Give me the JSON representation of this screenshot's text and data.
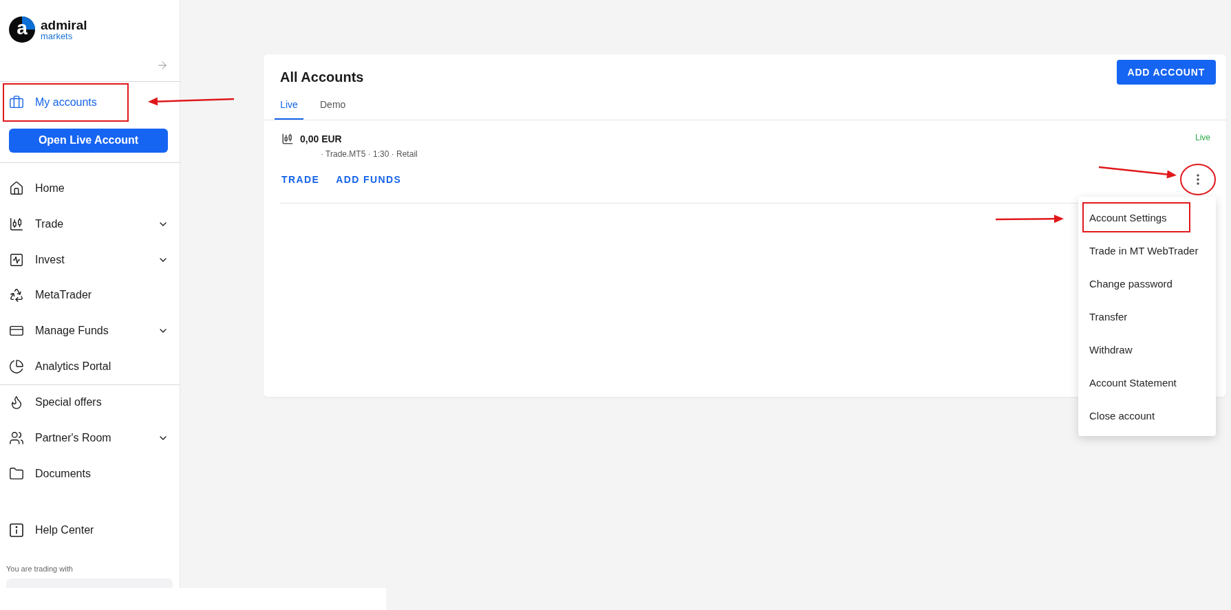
{
  "brand": {
    "mark": "a",
    "name": "admiral",
    "sub": "markets"
  },
  "sidebar": {
    "my_accounts": {
      "label": "My accounts",
      "selected": true,
      "highlighted": true
    },
    "cta": "Open Live Account",
    "items": [
      {
        "label": "Home",
        "kind": "home",
        "expandable": false
      },
      {
        "label": "Trade",
        "kind": "candles",
        "expandable": true
      },
      {
        "label": "Invest",
        "kind": "chart",
        "expandable": true
      },
      {
        "label": "MetaTrader",
        "kind": "recycle",
        "expandable": false
      },
      {
        "label": "Manage Funds",
        "kind": "card",
        "expandable": true
      },
      {
        "label": "Analytics Portal",
        "kind": "pie",
        "expandable": false
      }
    ],
    "secondary": [
      {
        "label": "Special offers",
        "kind": "flame",
        "expandable": false
      },
      {
        "label": "Partner's Room",
        "kind": "people",
        "expandable": true
      },
      {
        "label": "Documents",
        "kind": "folder",
        "expandable": false
      }
    ],
    "help": {
      "label": "Help Center",
      "kind": "info"
    },
    "trading_with": "You are trading with"
  },
  "page": {
    "title": "All Accounts",
    "add_button": "ADD ACCOUNT",
    "tabs": [
      {
        "label": "Live",
        "selected": true
      },
      {
        "label": "Demo",
        "selected": false
      }
    ],
    "account": {
      "balance": "0,00 EUR",
      "meta": [
        "· Trade.MT5",
        "· 1:30",
        "· Retail"
      ],
      "type": "Live",
      "actions": [
        "TRADE",
        "ADD FUNDS"
      ],
      "menu_open": true,
      "kebab_highlighted": true
    },
    "menu": [
      {
        "label": "Account Settings",
        "highlighted": true
      },
      {
        "label": "Trade in MT WebTrader",
        "highlighted": false
      },
      {
        "label": "Change password",
        "highlighted": false
      },
      {
        "label": "Transfer",
        "highlighted": false
      },
      {
        "label": "Withdraw",
        "highlighted": false
      },
      {
        "label": "Account Statement",
        "highlighted": false
      },
      {
        "label": "Close account",
        "highlighted": false
      }
    ]
  }
}
